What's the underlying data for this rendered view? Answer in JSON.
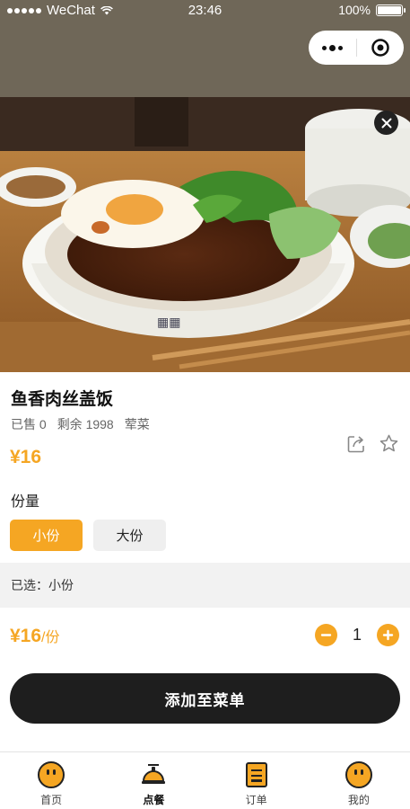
{
  "status_bar": {
    "carrier": "WeChat",
    "time": "23:46",
    "battery": "100%"
  },
  "product": {
    "name": "鱼香肉丝盖饭",
    "sold": "已售 0",
    "remaining": "剩余 1998",
    "tag": "荤菜",
    "price": "¥16"
  },
  "size": {
    "label": "份量",
    "options": [
      "小份",
      "大份"
    ],
    "selected_index": 0
  },
  "selected_text": "已选：小份",
  "order": {
    "total": "¥16",
    "unit": "/份",
    "quantity": "1",
    "add_button": "添加至菜单"
  },
  "tabbar": {
    "items": [
      {
        "label": "首页",
        "icon": "smiley-icon"
      },
      {
        "label": "点餐",
        "icon": "service-bell-icon"
      },
      {
        "label": "订单",
        "icon": "order-list-icon"
      },
      {
        "label": "我的",
        "icon": "smiley-icon"
      }
    ],
    "active_index": 1
  },
  "colors": {
    "accent": "#f5a623",
    "button_dark": "#1e1e1e"
  }
}
